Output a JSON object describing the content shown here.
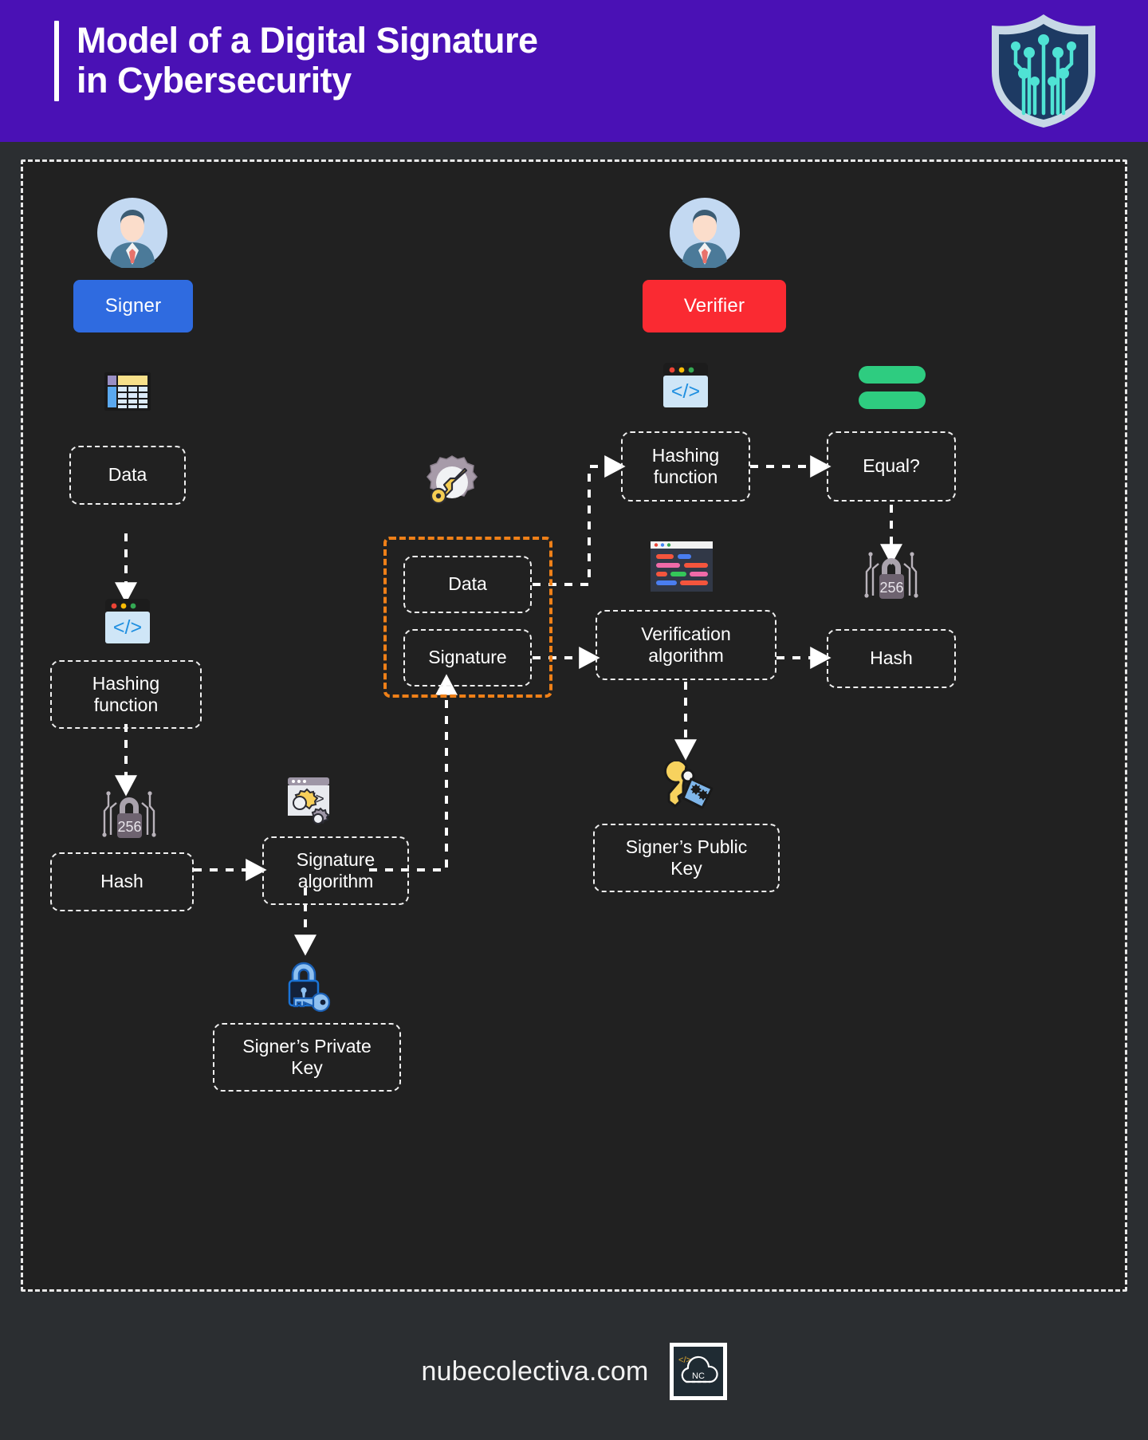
{
  "header": {
    "title": "Model of a Digital Signature\nin Cybersecurity",
    "accent_color": "#4a11b5",
    "logo_icon": "shield-circuit-icon"
  },
  "theme": {
    "canvas_bg": "#212121",
    "page_bg": "#2b2e31",
    "box_border": "#f0f0f0",
    "group_border": "#ef8018",
    "signer_color": "#2f6be0",
    "verifier_color": "#fa2a32",
    "equals_color": "#2ecc80"
  },
  "roles": {
    "signer": {
      "label": "Signer",
      "avatar_icon": "user-avatar-icon"
    },
    "verifier": {
      "label": "Verifier",
      "avatar_icon": "user-avatar-icon"
    }
  },
  "nodes": {
    "signer_data": {
      "label": "Data",
      "icon": "spreadsheet-table-icon"
    },
    "signer_hashing": {
      "label": "Hashing\nfunction",
      "icon": "code-window-icon"
    },
    "signer_hash": {
      "label": "Hash",
      "icon": "lock-256-icon",
      "icon_text": "256"
    },
    "signature_algorithm": {
      "label": "Signature\nalgorithm",
      "icon": "code-gears-icon"
    },
    "private_key": {
      "label": "Signer’s Private\nKey",
      "icon": "lock-key-blue-icon"
    },
    "packet_data": {
      "label": "Data"
    },
    "packet_signature": {
      "label": "Signature"
    },
    "packet_icon": "gear-key-icon",
    "verifier_hashing": {
      "label": "Hashing\nfunction",
      "icon": "code-window-icon"
    },
    "equal": {
      "label": "Equal?",
      "icon": "equals-green-icon"
    },
    "verification_algorithm": {
      "label": "Verification\nalgorithm",
      "icon": "code-editor-icon"
    },
    "verifier_hash": {
      "label": "Hash",
      "icon": "lock-256-icon",
      "icon_text": "256"
    },
    "public_key": {
      "label": "Signer’s Public\nKey",
      "icon": "key-tag-icon"
    }
  },
  "footer": {
    "site": "nubecolectiva.com",
    "logo_icon": "nube-colectiva-cloud-icon",
    "logo_text": "NC",
    "logo_code": "</>"
  }
}
